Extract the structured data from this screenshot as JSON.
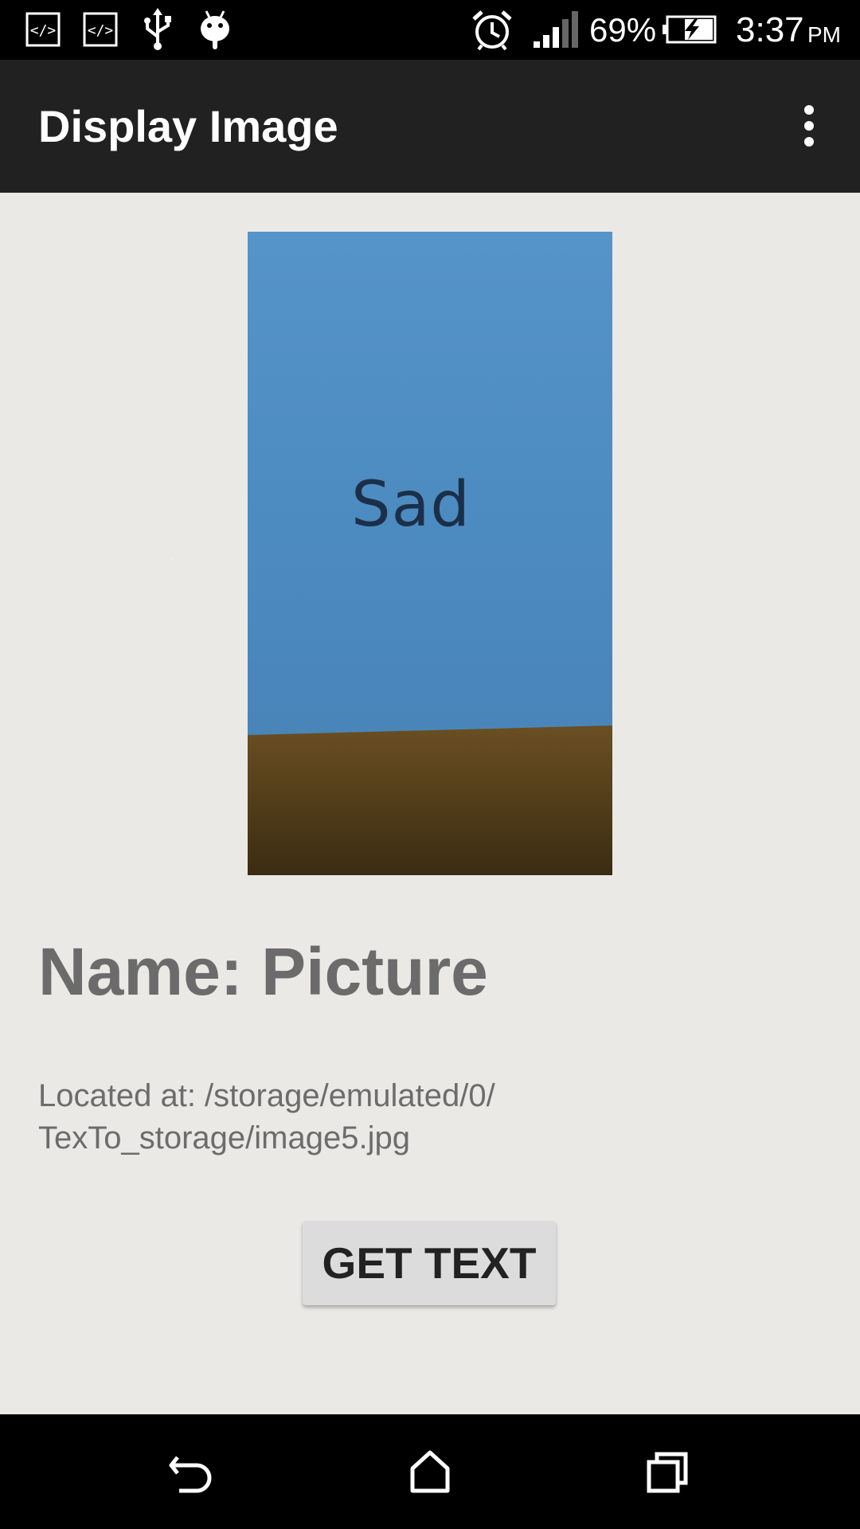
{
  "status_bar": {
    "icons_left": [
      "code-icon",
      "code-icon",
      "usb-icon",
      "android-debug-icon"
    ],
    "alarm_icon": "alarm-clock-icon",
    "signal_icon": "cell-signal-icon",
    "battery_level": "69%",
    "battery_icon": "battery-charging-icon",
    "time": "3:37",
    "ampm": "PM"
  },
  "app_bar": {
    "title": "Display Image",
    "overflow_icon": "more-vert-icon"
  },
  "image": {
    "caption_in_photo": "Sad",
    "paper_color": "#4c8bc0",
    "table_color": "#4e3a18"
  },
  "details": {
    "name_line": "Name: Picture",
    "location_line1": "Located at: /storage/emulated/0/",
    "location_line2": "TexTo_storage/image5.jpg"
  },
  "actions": {
    "get_text_label": "GET TEXT"
  },
  "nav_bar": {
    "back_icon": "back-icon",
    "home_icon": "home-icon",
    "recents_icon": "recents-icon"
  }
}
